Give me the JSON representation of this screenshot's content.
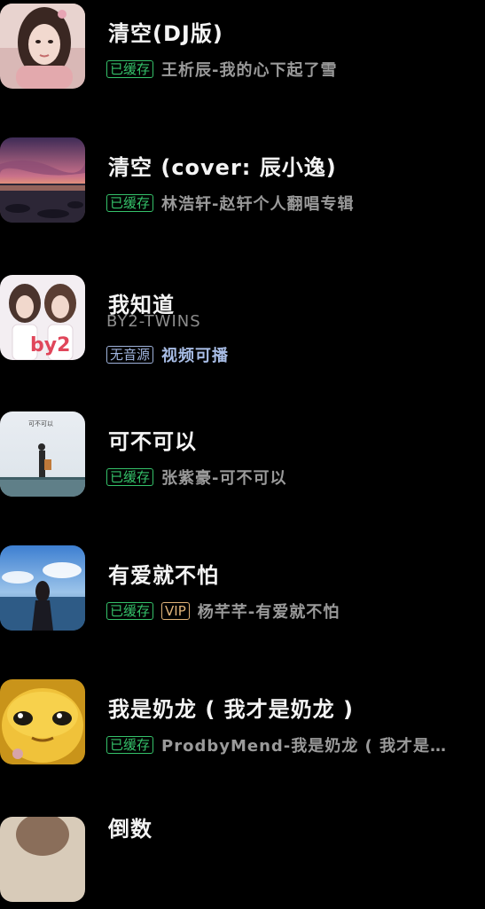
{
  "tags": {
    "cached": "已缓存",
    "vip": "VIP",
    "no_source": "无音源"
  },
  "songs": [
    {
      "title": "清空(DJ版)",
      "subtitle": "王析辰-我的心下起了雪",
      "cover": "girl-portrait-cover"
    },
    {
      "title": "清空 (cover: 辰小逸)",
      "subtitle": "林浩轩-赵轩个人翻唱专辑",
      "cover": "sunset-lake-cover"
    },
    {
      "title": "我知道",
      "artist": "BY2-TWINS",
      "video_label": "视频可播",
      "cover": "by2-twins-cover"
    },
    {
      "title": "可不可以",
      "subtitle": "张紫豪-可不可以",
      "cover": "guitar-seaside-cover"
    },
    {
      "title": "有爱就不怕",
      "subtitle": "杨芊芊-有爱就不怕",
      "cover": "girl-sea-cover"
    },
    {
      "title": "我是奶龙 ( 我才是奶龙 )",
      "subtitle": "ProdbyMend-我是奶龙 ( 我才是奶...",
      "cover": "yellow-dragon-cover"
    },
    {
      "title": "倒数",
      "cover": "portrait-cover"
    }
  ],
  "colors": {
    "background": "#000000",
    "cached_tag": "#35c26a",
    "vip_tag": "#e1b47a",
    "no_source_tag": "#9fb3dc",
    "subtitle": "#9a9a9a"
  }
}
